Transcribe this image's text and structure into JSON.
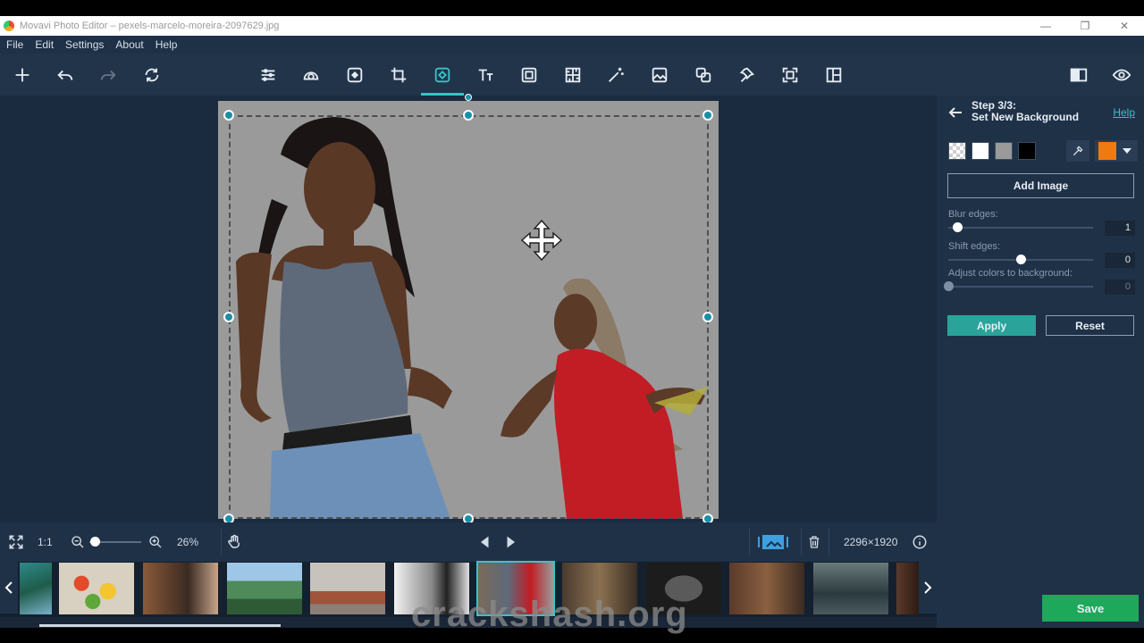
{
  "window": {
    "title": "Movavi Photo Editor – pexels-marcelo-moreira-2097629.jpg",
    "controls": {
      "minimize": "—",
      "restore": "❐",
      "close": "✕"
    }
  },
  "menu": [
    "File",
    "Edit",
    "Settings",
    "About",
    "Help"
  ],
  "toolbar": {
    "left_icons": [
      "add-icon",
      "undo-icon",
      "redo-icon",
      "rotate-icon"
    ],
    "center_icons": [
      "adjust-icon",
      "filters-icon",
      "retouch-icon",
      "crop-icon",
      "background-removal-icon",
      "text-icon",
      "frames-icon",
      "texture-icon",
      "magic-wand-icon",
      "image-icon",
      "overlay-icon",
      "pin-icon",
      "resize-icon",
      "layout-icon"
    ],
    "active_tool": "background-removal-icon",
    "right_icons": [
      "compare-icon",
      "preview-eye-icon"
    ]
  },
  "bottom": {
    "one_to_one": "1:1",
    "zoom_percent": "26%",
    "zoom_level": 0.1,
    "dimensions": "2296×1920"
  },
  "filmstrip": {
    "thumbnails": [
      "thumb-landscape",
      "thumb-food",
      "thumb-woman",
      "thumb-mountain",
      "thumb-city",
      "thumb-couple",
      "thumb-selected",
      "thumb-buildings",
      "thumb-face",
      "thumb-curly",
      "thumb-street",
      "thumb-partial"
    ],
    "selected_index": 6,
    "scroll_position": 0.25
  },
  "panel": {
    "step_line1": "Step 3/3:",
    "step_line2": "Set New Background",
    "help": "Help",
    "swatches": [
      "#f0f0f0",
      "#ffffff",
      "#9a9a9a",
      "#000000"
    ],
    "selected_color": "#f07a10",
    "add_image": "Add Image",
    "sliders": [
      {
        "label": "Blur edges:",
        "value": "1",
        "fraction": 0.06
      },
      {
        "label": "Shift edges:",
        "value": "0",
        "fraction": 0.5
      },
      {
        "label": "Adjust colors to background:",
        "value": "0",
        "fraction": 0.0
      }
    ],
    "apply": "Apply",
    "reset": "Reset",
    "save": "Save"
  },
  "colors": {
    "accent": "#38c3c8",
    "apply": "#2aa39b",
    "save": "#1ea85a",
    "background": "#1b2b3f"
  },
  "watermark": "crackshash.org"
}
